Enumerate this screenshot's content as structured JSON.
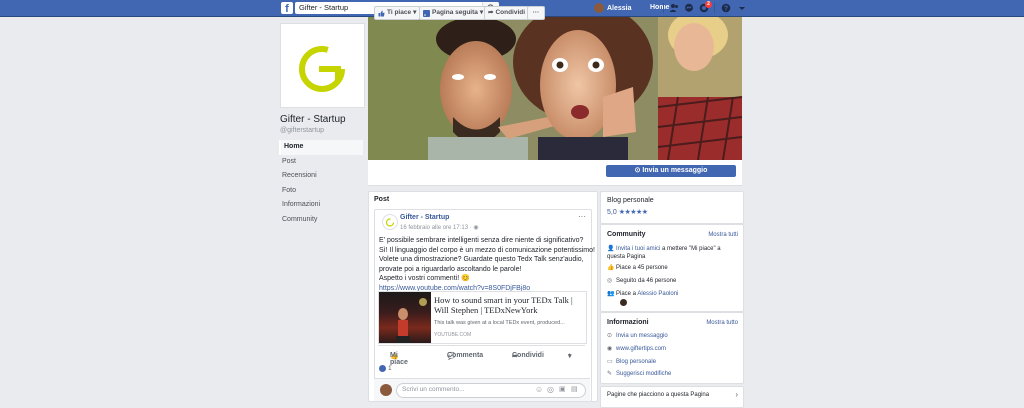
{
  "topbar": {
    "logo": "f",
    "search_value": "Gifter - Startup",
    "user_name": "Alessia",
    "home": "Home",
    "notif_count": "2",
    "icons": [
      "search-icon",
      "friends-icon",
      "messenger-icon",
      "notifications-icon",
      "help-icon",
      "chevron-down-icon"
    ]
  },
  "page": {
    "title": "Gifter - Startup",
    "handle": "@gifterstartup",
    "logo_letter": "G",
    "logo_color": "#c6d400"
  },
  "left_nav": [
    "Home",
    "Post",
    "Recensioni",
    "Foto",
    "Informazioni",
    "Community"
  ],
  "actions": {
    "like": "Ti piace",
    "follow": "Pagina seguita",
    "share": "Condividi",
    "more": "···",
    "message": "Invia un messaggio"
  },
  "post": {
    "header": "Post",
    "author": "Gifter - Startup",
    "date": "16 febbraio alle ore 17:13 · ",
    "lines": [
      "E' possibile sembrare intelligenti senza dire niente di significativo?",
      "Sì! Il linguaggio del corpo è un mezzo di comunicazione potentissimo!",
      "Volete una dimostrazione? Guardate questo Tedx Talk senz'audio,",
      "provate poi a riguardarlo ascoltando le parole!",
      "Aspetto i vostri commenti! 😊"
    ],
    "url": "https://www.youtube.com/watch?v=8S0FDjFBj8o",
    "link_title": "How to sound smart in your TEDx Talk | Will Stephen | TEDxNewYork",
    "link_desc": "This talk was given at a local TEDx event, produced...",
    "link_domain": "YOUTUBE.COM",
    "like": "Mi piace",
    "comment": "Commenta",
    "share": "Condividi",
    "likes_count": "1",
    "comment_placeholder": "Scrivi un commento..."
  },
  "blog": {
    "title": "Blog personale",
    "rating": "5,0",
    "stars": "★★★★★"
  },
  "community": {
    "title": "Community",
    "more": "Mostra tutti",
    "invite_link": "Invita i tuoi amici",
    "invite_rest": " a mettere \"Mi piace\" a questa Pagina",
    "likes": "Piace a 45 persone",
    "follows": "Seguito da 46 persone",
    "liked_by_prefix": "Piace a ",
    "liked_by_name": "Alessio Paoloni"
  },
  "info": {
    "title": "Informazioni",
    "more": "Mostra tutto",
    "items": [
      "Invia un messaggio",
      "www.giftertips.com",
      "Blog personale",
      "Suggerisci modifiche"
    ]
  },
  "pages_liked": {
    "title": "Pagine che piacciono a questa Pagina"
  }
}
